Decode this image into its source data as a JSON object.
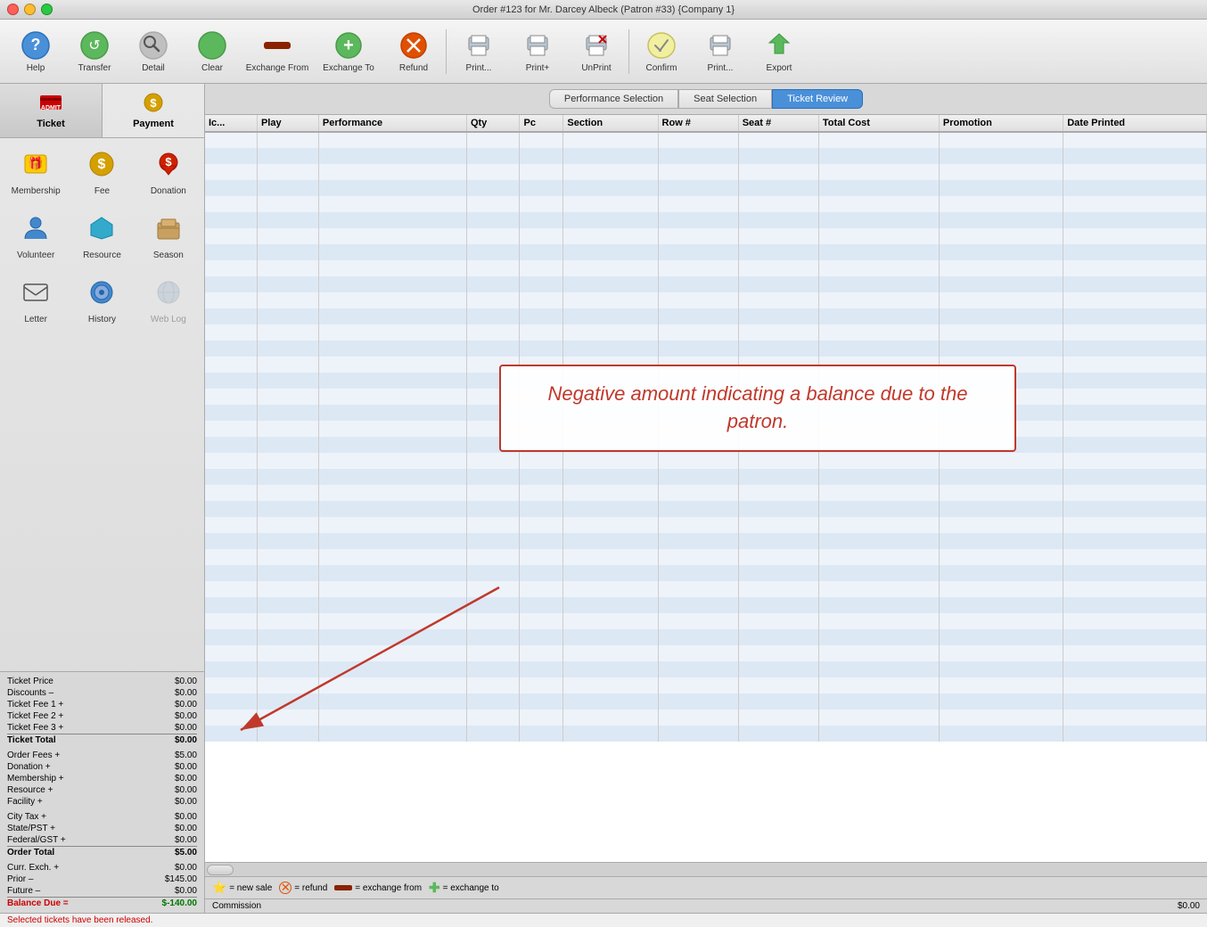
{
  "window": {
    "title": "Order #123 for Mr. Darcey Albeck (Patron #33) {Company 1}"
  },
  "toolbar": {
    "buttons": [
      {
        "id": "help",
        "label": "Help",
        "icon": "❓"
      },
      {
        "id": "transfer",
        "label": "Transfer",
        "icon": "🔄"
      },
      {
        "id": "detail",
        "label": "Detail",
        "icon": "🔍"
      },
      {
        "id": "clear",
        "label": "Clear",
        "icon": "🟢"
      },
      {
        "id": "exchange-from",
        "label": "Exchange From",
        "icon": "➖"
      },
      {
        "id": "exchange-to",
        "label": "Exchange To",
        "icon": "➕"
      },
      {
        "id": "refund",
        "label": "Refund",
        "icon": "⊗"
      },
      {
        "id": "print1",
        "label": "Print...",
        "icon": "🖨"
      },
      {
        "id": "print2",
        "label": "Print+",
        "icon": "🖨"
      },
      {
        "id": "unprint",
        "label": "UnPrint",
        "icon": "✂"
      },
      {
        "id": "confirm",
        "label": "Confirm",
        "icon": "✏"
      },
      {
        "id": "print3",
        "label": "Print...",
        "icon": "🖨"
      },
      {
        "id": "export",
        "label": "Export",
        "icon": "📤"
      }
    ]
  },
  "sidebar": {
    "tabs": [
      {
        "id": "ticket",
        "label": "Ticket",
        "icon": "🎫",
        "active": true
      },
      {
        "id": "payment",
        "label": "Payment",
        "icon": "💵",
        "active": false
      }
    ],
    "items": [
      {
        "id": "membership",
        "label": "Membership",
        "icon": "🎁",
        "disabled": false
      },
      {
        "id": "fee",
        "label": "Fee",
        "icon": "💰",
        "disabled": false
      },
      {
        "id": "donation",
        "label": "Donation",
        "icon": "💚",
        "disabled": false
      },
      {
        "id": "volunteer",
        "label": "Volunteer",
        "icon": "👤",
        "disabled": false
      },
      {
        "id": "resource",
        "label": "Resource",
        "icon": "🔷",
        "disabled": false
      },
      {
        "id": "season",
        "label": "Season",
        "icon": "📦",
        "disabled": false
      },
      {
        "id": "letter",
        "label": "Letter",
        "icon": "✉",
        "disabled": false
      },
      {
        "id": "history",
        "label": "History",
        "icon": "🔵",
        "disabled": false
      },
      {
        "id": "weblog",
        "label": "Web Log",
        "icon": "🌐",
        "disabled": true
      }
    ]
  },
  "summary": {
    "rows": [
      {
        "label": "Ticket Price",
        "value": "$0.00"
      },
      {
        "label": "Discounts –",
        "value": "$0.00"
      },
      {
        "label": "Ticket Fee 1 +",
        "value": "$0.00"
      },
      {
        "label": "Ticket Fee 2 +",
        "value": "$0.00"
      },
      {
        "label": "Ticket Fee 3 +",
        "value": "$0.00"
      },
      {
        "label": "Ticket Total",
        "value": "$0.00",
        "total": true
      },
      {
        "label": "Order Fees +",
        "value": "$5.00"
      },
      {
        "label": "Donation +",
        "value": "$0.00"
      },
      {
        "label": "Membership +",
        "value": "$0.00"
      },
      {
        "label": "Resource +",
        "value": "$0.00"
      },
      {
        "label": "Facility +",
        "value": "$0.00"
      },
      {
        "label": "City Tax +",
        "value": "$0.00"
      },
      {
        "label": "State/PST +",
        "value": "$0.00"
      },
      {
        "label": "Federal/GST +",
        "value": "$0.00"
      },
      {
        "label": "Order Total",
        "value": "$5.00",
        "total": true
      },
      {
        "label": "Curr. Exch. +",
        "value": "$0.00"
      },
      {
        "label": "Prior –",
        "value": "$145.00"
      },
      {
        "label": "Future –",
        "value": "$0.00"
      },
      {
        "label": "Balance Due =",
        "value": "$-140.00",
        "balance": true
      }
    ],
    "commission": {
      "label": "Commission",
      "value": "$0.00"
    }
  },
  "tabs": {
    "items": [
      {
        "id": "performance-selection",
        "label": "Performance Selection",
        "active": false
      },
      {
        "id": "seat-selection",
        "label": "Seat Selection",
        "active": false
      },
      {
        "id": "ticket-review",
        "label": "Ticket Review",
        "active": true
      }
    ]
  },
  "table": {
    "columns": [
      "Ic...",
      "Play",
      "Performance",
      "Qty",
      "Pc",
      "Section",
      "Row #",
      "Seat #",
      "Total Cost",
      "Promotion",
      "Date Printed"
    ],
    "rows": []
  },
  "annotation": {
    "text": "Negative amount indicating a balance due to the patron.",
    "arrow_from": "Negative amount in balance row"
  },
  "legend": {
    "items": [
      {
        "icon": "⭐",
        "label": "= new sale"
      },
      {
        "icon": "⊗",
        "label": "= refund"
      },
      {
        "icon": "—",
        "label": "= exchange from"
      },
      {
        "icon": "✚",
        "label": "= exchange to"
      }
    ]
  },
  "status": {
    "message": "Selected tickets have been released."
  }
}
